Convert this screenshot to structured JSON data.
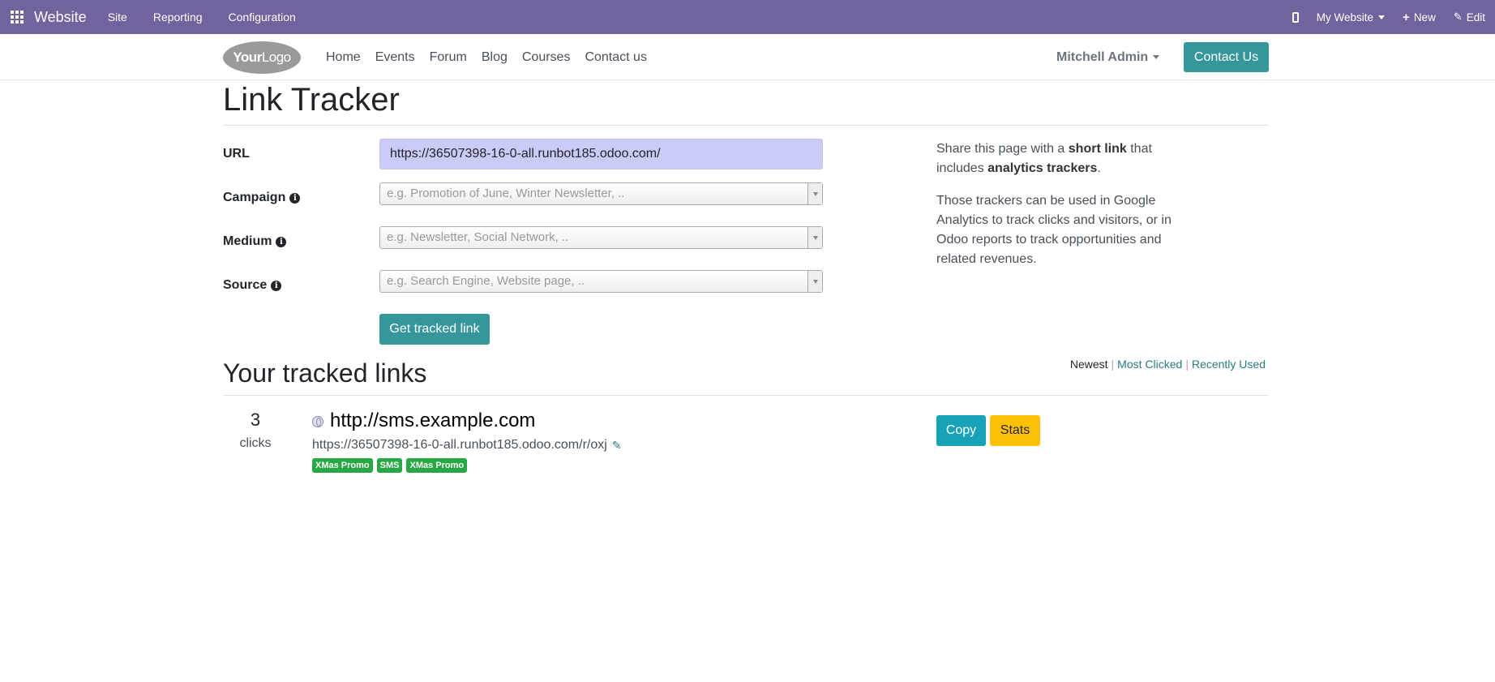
{
  "topbar": {
    "brand": "Website",
    "menu": [
      "Site",
      "Reporting",
      "Configuration"
    ],
    "website_selector": "My Website",
    "new_label": "New",
    "edit_label": "Edit"
  },
  "header": {
    "logo_bold": "Your",
    "logo_light": "Logo",
    "nav": [
      "Home",
      "Events",
      "Forum",
      "Blog",
      "Courses",
      "Contact us"
    ],
    "user": "Mitchell Admin",
    "contact_button": "Contact Us"
  },
  "page": {
    "title": "Link Tracker"
  },
  "form": {
    "url_label": "URL",
    "url_value": "https://36507398-16-0-all.runbot185.odoo.com/",
    "campaign_label": "Campaign",
    "campaign_placeholder": "e.g. Promotion of June, Winter Newsletter, ..",
    "medium_label": "Medium",
    "medium_placeholder": "e.g. Newsletter, Social Network, ..",
    "source_label": "Source",
    "source_placeholder": "e.g. Search Engine, Website page, ..",
    "submit_label": "Get tracked link"
  },
  "help": {
    "p1_a": "Share this page with a ",
    "p1_b": "short link",
    "p1_c": " that includes ",
    "p1_d": "analytics trackers",
    "p1_e": ".",
    "p2": "Those trackers can be used in Google Analytics to track clicks and visitors, or in Odoo reports to track opportunities and related revenues."
  },
  "tracked": {
    "title": "Your tracked links",
    "sort": [
      "Newest",
      "Most Clicked",
      "Recently Used"
    ],
    "links": [
      {
        "clicks": "3",
        "clicks_label": "clicks",
        "title": "http://sms.example.com",
        "short_url": "https://36507398-16-0-all.runbot185.odoo.com/r/oxj",
        "tags": [
          "XMas Promo",
          "SMS",
          "XMas Promo"
        ],
        "copy_label": "Copy",
        "stats_label": "Stats"
      }
    ]
  },
  "colors": {
    "topbar": "#71639e",
    "primary": "#35979c",
    "info": "#17a2b8",
    "warning": "#ffc107",
    "success": "#28a745"
  }
}
